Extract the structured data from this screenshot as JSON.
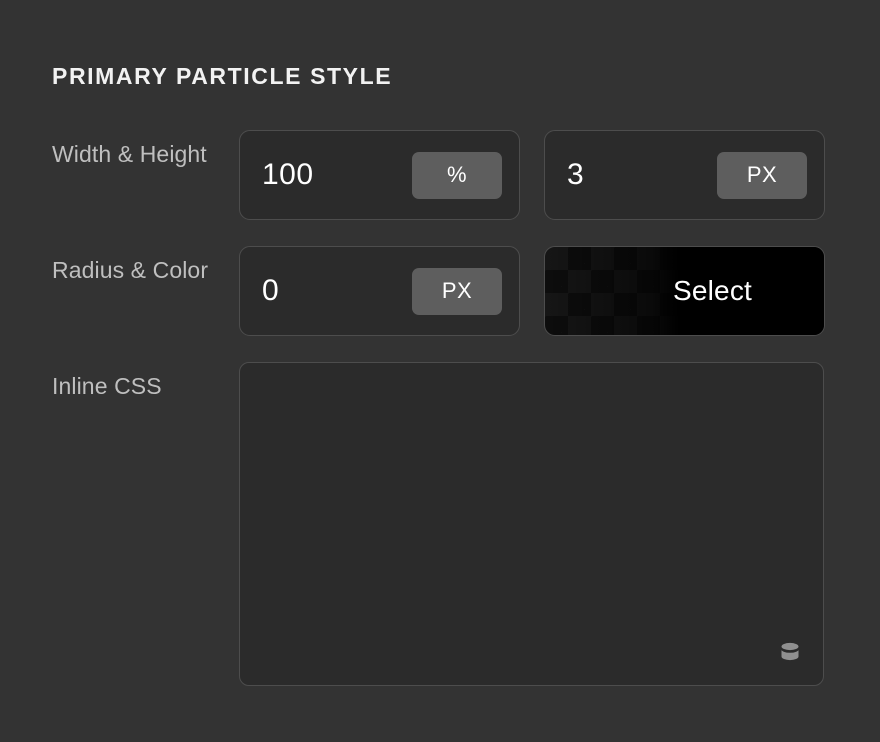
{
  "panel": {
    "title": "PRIMARY PARTICLE STYLE",
    "background_color": "#333333"
  },
  "rows": {
    "size": {
      "label": "Width & Height",
      "width": {
        "value": "100",
        "unit": "%"
      },
      "height": {
        "value": "3",
        "unit": "PX"
      }
    },
    "radius_color": {
      "label": "Radius & Color",
      "radius": {
        "value": "0",
        "unit": "PX"
      },
      "color": {
        "button_label": "Select",
        "swatch_color": "#000000",
        "icon": "checkerboard-transparency"
      }
    },
    "inline_css": {
      "label": "Inline CSS",
      "value": "",
      "resize_icon": "cylinder-resize-grip-icon"
    }
  },
  "colors": {
    "panel_bg": "#333333",
    "field_bg": "#2b2b2b",
    "field_border": "#4d4d4d",
    "unit_button_bg": "#5e5e5e",
    "label_text": "#bfbfbf",
    "value_text": "#ffffff",
    "title_text": "#f2f2f2",
    "grip_icon": "#8f8f8f"
  }
}
